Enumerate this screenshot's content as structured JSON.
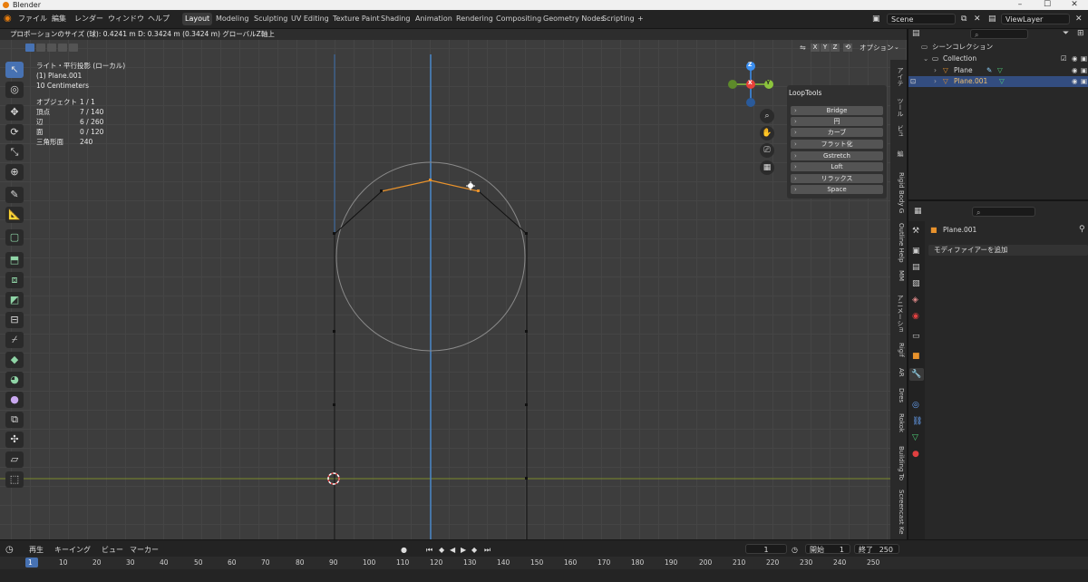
{
  "window": {
    "title": "Blender",
    "controls": [
      "–",
      "☐",
      "✕"
    ]
  },
  "menu": {
    "items": [
      "ファイル",
      "編集",
      "レンダー",
      "ウィンドウ",
      "ヘルプ"
    ],
    "workspaces": [
      "Layout",
      "Modeling",
      "Sculpting",
      "UV Editing",
      "Texture Paint",
      "Shading",
      "Animation",
      "Rendering",
      "Compositing",
      "Geometry Nodes",
      "Scripting"
    ],
    "add_workspace": "+",
    "scene": "Scene",
    "view_layer": "ViewLayer"
  },
  "viewport": {
    "status_text": "プロポーションのサイズ (球): 0.4241 m  D: 0.3424 m (0.3424 m) グローバルZ軸上",
    "axes_buttons": [
      "X",
      "Y",
      "Z"
    ],
    "options_label": "オプション",
    "view_name": "ライト・平行投影 (ローカル)",
    "object_name": "(1) Plane.001",
    "scale_text": "10 Centimeters",
    "stats": [
      {
        "label": "オブジェクト",
        "value": "1 / 1"
      },
      {
        "label": "頂点",
        "value": "7 / 140"
      },
      {
        "label": "辺",
        "value": "6 / 260"
      },
      {
        "label": "面",
        "value": "0 / 120"
      },
      {
        "label": "三角形面",
        "value": "240"
      }
    ],
    "gizmo": {
      "z": "Z",
      "x": "X",
      "y": "Y"
    },
    "colors": {
      "x": "#e8413a",
      "y": "#8cc43c",
      "z": "#3b8ff0",
      "selected_edge": "#e8922c",
      "accent": "#4772b3"
    }
  },
  "looptools": {
    "title": "LoopTools",
    "buttons": [
      "Bridge",
      "円",
      "カーブ",
      "フラット化",
      "Gstretch",
      "Loft",
      "リラックス",
      "Space"
    ]
  },
  "side_tabs": [
    "アイテ",
    "ツール",
    "ビュ",
    "編",
    "Rigid Body G",
    "Outline Help",
    "MM",
    "アニメーショ",
    "Rigif",
    "AR",
    "Dres",
    "Rokok",
    "Building To",
    "Screencast Ke"
  ],
  "outliner": {
    "root": "シーンコレクション",
    "collection": "Collection",
    "items": [
      "Plane",
      "Plane.001"
    ]
  },
  "properties": {
    "object_name": "Plane.001",
    "add_modifier": "モディファイアーを追加"
  },
  "timeline": {
    "menus": [
      "再生",
      "キーイング",
      "ビュー",
      "マーカー"
    ],
    "current_frame": "1",
    "start_label": "開始",
    "start": "1",
    "end_label": "終了",
    "end": "250",
    "ticks": [
      "1",
      "10",
      "20",
      "30",
      "40",
      "50",
      "60",
      "70",
      "80",
      "90",
      "100",
      "110",
      "120",
      "130",
      "140",
      "150",
      "160",
      "170",
      "180",
      "190",
      "200",
      "210",
      "220",
      "230",
      "240",
      "250"
    ]
  }
}
